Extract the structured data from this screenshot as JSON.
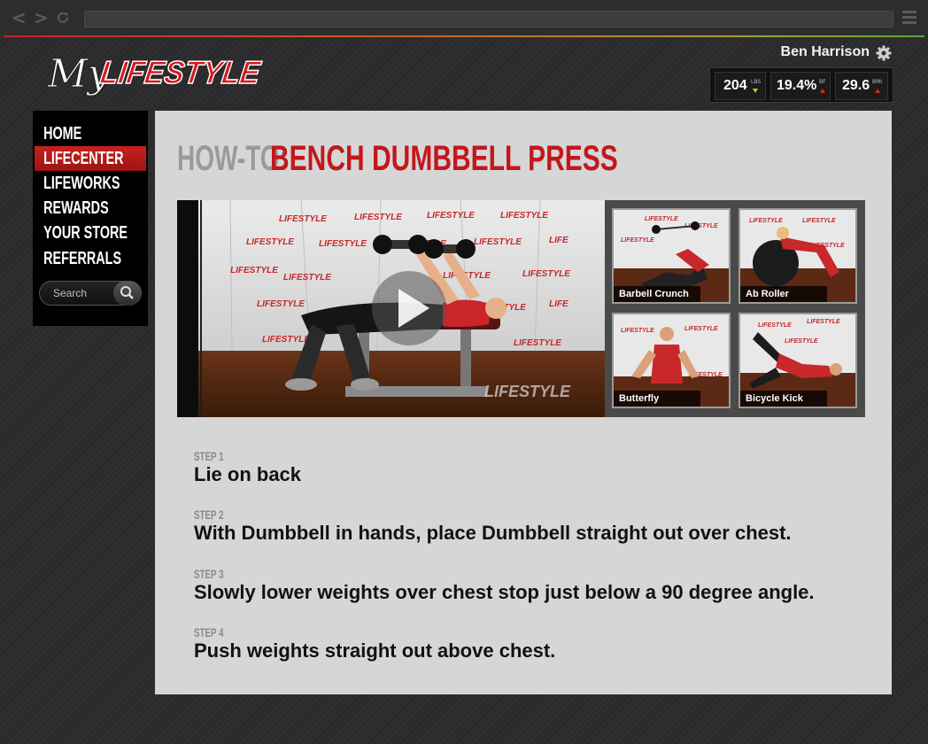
{
  "browser": {
    "back_label": "<",
    "forward_label": ">"
  },
  "logo": {
    "my": "My",
    "brand": "LIFESTYLE"
  },
  "user": {
    "name": "Ben Harrison"
  },
  "stats": [
    {
      "value": "204",
      "unit": "LBS",
      "trend": "down"
    },
    {
      "value": "19.4%",
      "unit": "BF",
      "trend": "up"
    },
    {
      "value": "29.6",
      "unit": "BMI",
      "trend": "up"
    }
  ],
  "nav": {
    "items": [
      "HOME",
      "LIFECENTER",
      "LIFEWORKS",
      "REWARDS",
      "YOUR STORE",
      "REFERRALS"
    ],
    "active": "LIFECENTER"
  },
  "search": {
    "placeholder": "Search"
  },
  "main": {
    "title_prefix": "HOW-TO:",
    "title_name": "BENCH DUMBBELL PRESS",
    "video_watermark": "LIFESTYLE",
    "thumbnails": [
      "Barbell Crunch",
      "Ab Roller",
      "Butterfly",
      "Bicycle Kick"
    ],
    "steps": [
      {
        "label": "STEP 1",
        "text": "Lie on back"
      },
      {
        "label": "STEP 2",
        "text": "With Dumbbell in hands, place Dumbbell straight out over chest."
      },
      {
        "label": "STEP 3",
        "text": "Slowly lower weights over chest stop just below a 90 degree angle."
      },
      {
        "label": "STEP 4",
        "text": "Push weights straight out above chest."
      }
    ]
  },
  "colors": {
    "brand_red": "#c3171c",
    "nav_active": "#c6211f"
  }
}
